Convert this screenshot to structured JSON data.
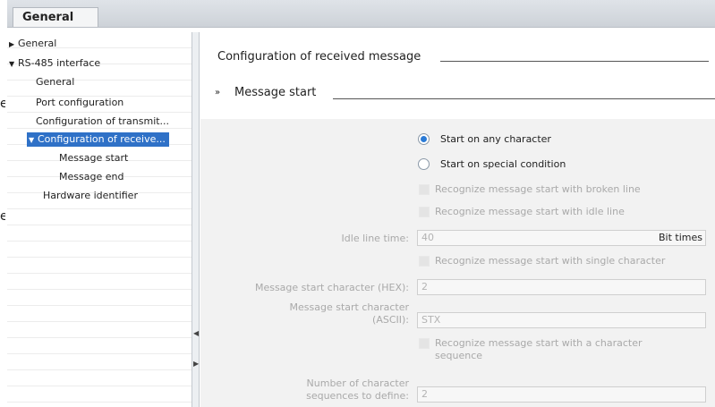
{
  "tabs": [
    {
      "label": "General"
    }
  ],
  "tree": {
    "items": [
      {
        "label": "General",
        "expander": "right"
      },
      {
        "label": "RS-485 interface",
        "expander": "down"
      },
      {
        "label": "General"
      },
      {
        "label": "Port configuration"
      },
      {
        "label": "Configuration of transmit..."
      },
      {
        "label": "Configuration of receive...",
        "expander": "down",
        "selected": true
      },
      {
        "label": "Message start"
      },
      {
        "label": "Message end"
      },
      {
        "label": "Hardware identifier"
      }
    ]
  },
  "page_edge": {
    "text1": "e",
    "text2": "e"
  },
  "content": {
    "section_title": "Configuration of received message",
    "subsection_title": "Message start",
    "subsection_chevron": "»",
    "radio_any": "Start on any character",
    "radio_special": "Start on special condition",
    "radio_selected": "any",
    "chk_broken_line": "Recognize message start with broken line",
    "chk_idle_line": "Recognize message start with idle line",
    "idle_time_label": "Idle line time:",
    "idle_time_value": "40",
    "idle_time_unit": "Bit times",
    "chk_single_char": "Recognize message start with single character",
    "start_char_hex_label": "Message start character (HEX):",
    "start_char_hex_value": "2",
    "start_char_ascii_label_1": "Message start character",
    "start_char_ascii_label_2": "(ASCII):",
    "start_char_ascii_value": "STX",
    "chk_char_seq_1": "Recognize message start with a character",
    "chk_char_seq_2": "sequence",
    "num_seq_label_1": "Number of character",
    "num_seq_label_2": "sequences to define:",
    "num_seq_value": "2"
  }
}
